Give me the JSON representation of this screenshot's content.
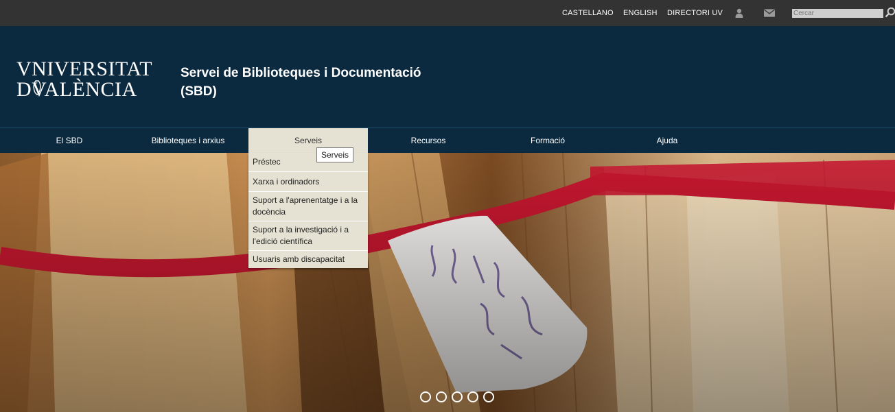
{
  "topbar": {
    "links": [
      "CASTELLANO",
      "ENGLISH",
      "DIRECTORI UV"
    ],
    "user_icon": "user-icon",
    "mail_icon": "envelope-icon",
    "search_placeholder": "Cercar",
    "search_icon": "search-icon"
  },
  "header": {
    "logo_line1": "VNIVERSITAT",
    "logo_line2": "DVALÈNCIA",
    "title": "Servei de Biblioteques i Documentació (SBD)"
  },
  "nav": {
    "items": [
      "El SBD",
      "Biblioteques i arxius",
      "Serveis",
      "Recursos",
      "Formació",
      "Ajuda"
    ],
    "active": "Serveis"
  },
  "dropdown": {
    "items": [
      "Préstec",
      "Xarxa i ordinadors",
      "Suport a l'aprenentatge i a la docència",
      "Suport a la investigació i a l'edició científica",
      "Usuaris amb discapacitat"
    ]
  },
  "tooltip": "Serveis",
  "carousel": {
    "slide_count": 5
  },
  "colors": {
    "topbar": "#333333",
    "header": "#0b2a3f",
    "nav_active": "#e6e2d3"
  }
}
